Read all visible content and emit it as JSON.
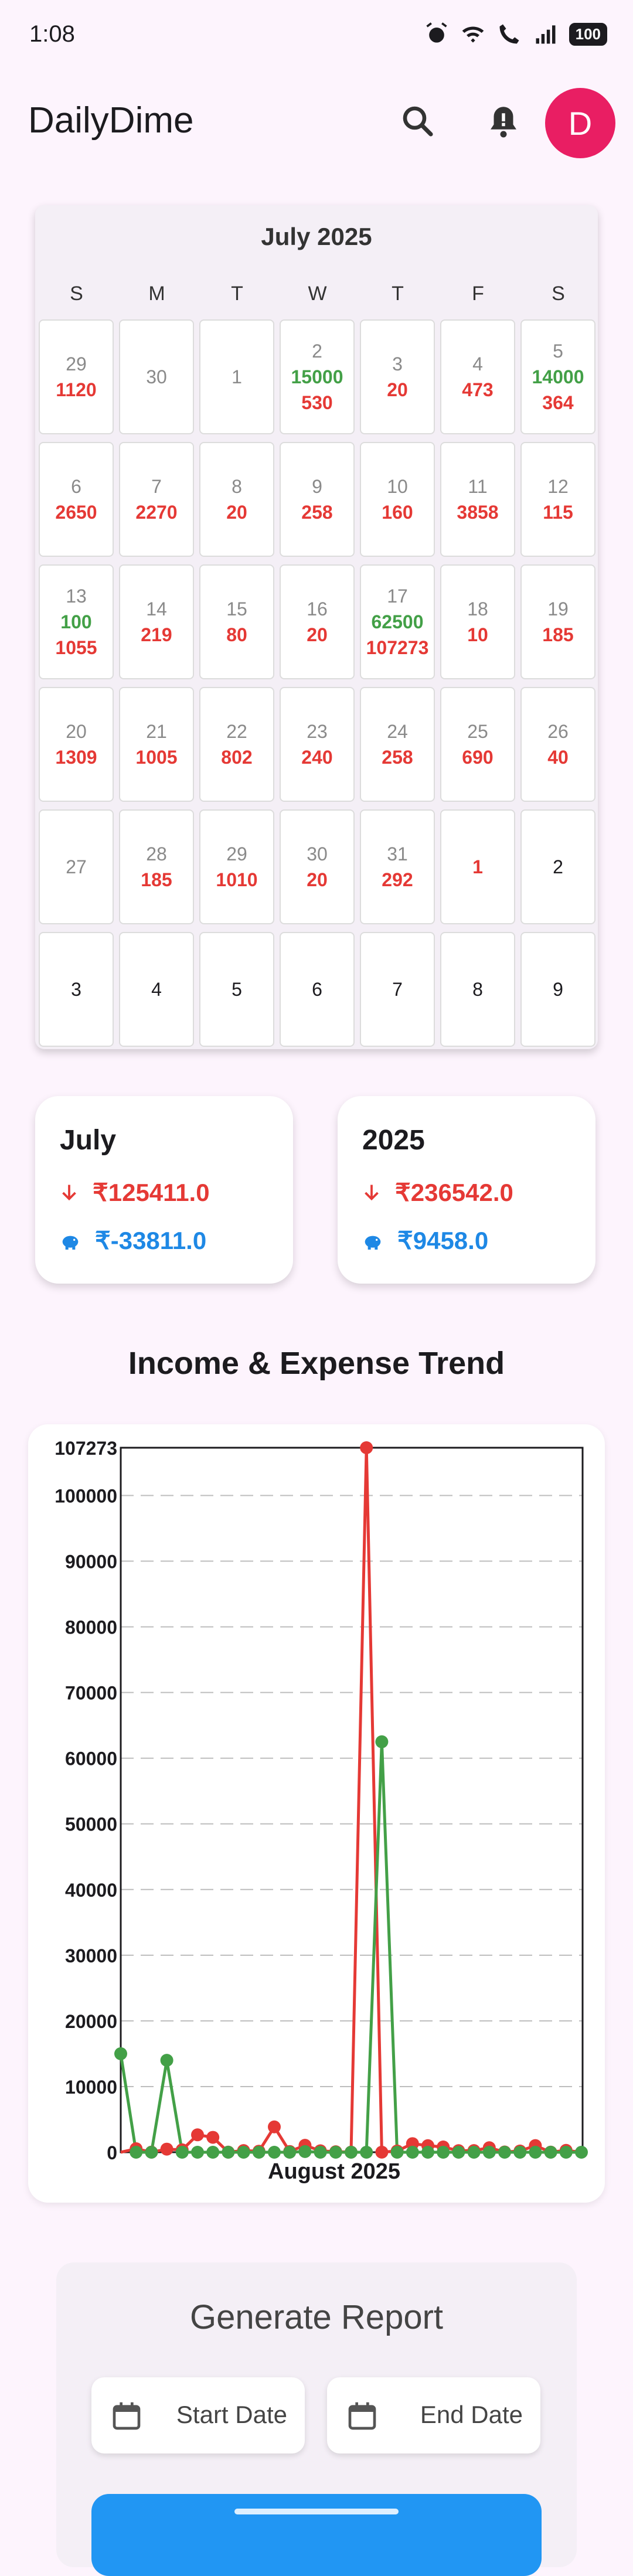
{
  "status_bar": {
    "time": "1:08",
    "battery": "100"
  },
  "app_bar": {
    "title": "DailyDime",
    "avatar_letter": "D"
  },
  "calendar": {
    "month_title": "July 2025",
    "weekdays": [
      "S",
      "M",
      "T",
      "W",
      "T",
      "F",
      "S"
    ],
    "weeks": [
      [
        {
          "day": "29",
          "inc": "",
          "exp": "1120",
          "style": "grey"
        },
        {
          "day": "30",
          "inc": "",
          "exp": "",
          "style": "grey"
        },
        {
          "day": "1",
          "inc": "",
          "exp": "",
          "style": "grey"
        },
        {
          "day": "2",
          "inc": "15000",
          "exp": "530",
          "style": "grey"
        },
        {
          "day": "3",
          "inc": "",
          "exp": "20",
          "style": "grey"
        },
        {
          "day": "4",
          "inc": "",
          "exp": "473",
          "style": "grey"
        },
        {
          "day": "5",
          "inc": "14000",
          "exp": "364",
          "style": "grey"
        }
      ],
      [
        {
          "day": "6",
          "inc": "",
          "exp": "2650",
          "style": "grey"
        },
        {
          "day": "7",
          "inc": "",
          "exp": "2270",
          "style": "grey"
        },
        {
          "day": "8",
          "inc": "",
          "exp": "20",
          "style": "grey"
        },
        {
          "day": "9",
          "inc": "",
          "exp": "258",
          "style": "grey"
        },
        {
          "day": "10",
          "inc": "",
          "exp": "160",
          "style": "grey"
        },
        {
          "day": "11",
          "inc": "",
          "exp": "3858",
          "style": "grey"
        },
        {
          "day": "12",
          "inc": "",
          "exp": "115",
          "style": "grey"
        }
      ],
      [
        {
          "day": "13",
          "inc": "100",
          "exp": "1055",
          "style": "grey"
        },
        {
          "day": "14",
          "inc": "",
          "exp": "219",
          "style": "grey"
        },
        {
          "day": "15",
          "inc": "",
          "exp": "80",
          "style": "grey"
        },
        {
          "day": "16",
          "inc": "",
          "exp": "20",
          "style": "grey"
        },
        {
          "day": "17",
          "inc": "62500",
          "exp": "107273",
          "style": "grey"
        },
        {
          "day": "18",
          "inc": "",
          "exp": "10",
          "style": "grey"
        },
        {
          "day": "19",
          "inc": "",
          "exp": "185",
          "style": "grey"
        }
      ],
      [
        {
          "day": "20",
          "inc": "",
          "exp": "1309",
          "style": "grey"
        },
        {
          "day": "21",
          "inc": "",
          "exp": "1005",
          "style": "grey"
        },
        {
          "day": "22",
          "inc": "",
          "exp": "802",
          "style": "grey"
        },
        {
          "day": "23",
          "inc": "",
          "exp": "240",
          "style": "grey"
        },
        {
          "day": "24",
          "inc": "",
          "exp": "258",
          "style": "grey"
        },
        {
          "day": "25",
          "inc": "",
          "exp": "690",
          "style": "grey"
        },
        {
          "day": "26",
          "inc": "",
          "exp": "40",
          "style": "grey"
        }
      ],
      [
        {
          "day": "27",
          "inc": "",
          "exp": "",
          "style": "grey"
        },
        {
          "day": "28",
          "inc": "",
          "exp": "185",
          "style": "grey"
        },
        {
          "day": "29",
          "inc": "",
          "exp": "1010",
          "style": "grey"
        },
        {
          "day": "30",
          "inc": "",
          "exp": "20",
          "style": "grey"
        },
        {
          "day": "31",
          "inc": "",
          "exp": "292",
          "style": "grey"
        },
        {
          "day": "1",
          "inc": "",
          "exp": "",
          "style": "red"
        },
        {
          "day": "2",
          "inc": "",
          "exp": "",
          "style": "black"
        }
      ],
      [
        {
          "day": "3",
          "inc": "",
          "exp": "",
          "style": "black"
        },
        {
          "day": "4",
          "inc": "",
          "exp": "",
          "style": "black"
        },
        {
          "day": "5",
          "inc": "",
          "exp": "",
          "style": "black"
        },
        {
          "day": "6",
          "inc": "",
          "exp": "",
          "style": "black"
        },
        {
          "day": "7",
          "inc": "",
          "exp": "",
          "style": "black"
        },
        {
          "day": "8",
          "inc": "",
          "exp": "",
          "style": "black"
        },
        {
          "day": "9",
          "inc": "",
          "exp": "",
          "style": "black"
        }
      ]
    ]
  },
  "summary": {
    "month": {
      "title": "July",
      "expense": "₹125411.0",
      "savings": "₹-33811.0"
    },
    "year": {
      "title": "2025",
      "expense": "₹236542.0",
      "savings": "₹9458.0"
    }
  },
  "trend": {
    "title": "Income & Expense Trend"
  },
  "chart_data": {
    "type": "line",
    "xlabel": "August 2025",
    "ylim": [
      0,
      107273
    ],
    "y_ticks": [
      "107273",
      "100000",
      "90000",
      "80000",
      "70000",
      "60000",
      "50000",
      "40000",
      "30000",
      "20000",
      "10000",
      "0"
    ],
    "grid": true,
    "colors": {
      "income": "#43a047",
      "expense": "#e53935"
    },
    "series": [
      {
        "key": "income",
        "values": [
          15000,
          0,
          0,
          14000,
          0,
          0,
          0,
          0,
          0,
          0,
          0,
          0,
          100,
          0,
          0,
          0,
          0,
          62500,
          0,
          0,
          0,
          0,
          0,
          0,
          0,
          0,
          0,
          0,
          0,
          0,
          0
        ]
      },
      {
        "key": "expense",
        "values": [
          0,
          530,
          20,
          473,
          364,
          2650,
          2270,
          20,
          258,
          160,
          3858,
          115,
          1055,
          219,
          80,
          20,
          107273,
          10,
          185,
          1309,
          1005,
          802,
          240,
          258,
          690,
          40,
          185,
          1010,
          20,
          292,
          0
        ]
      }
    ]
  },
  "report": {
    "title": "Generate Report",
    "start_label": "Start Date",
    "end_label": "End Date"
  }
}
